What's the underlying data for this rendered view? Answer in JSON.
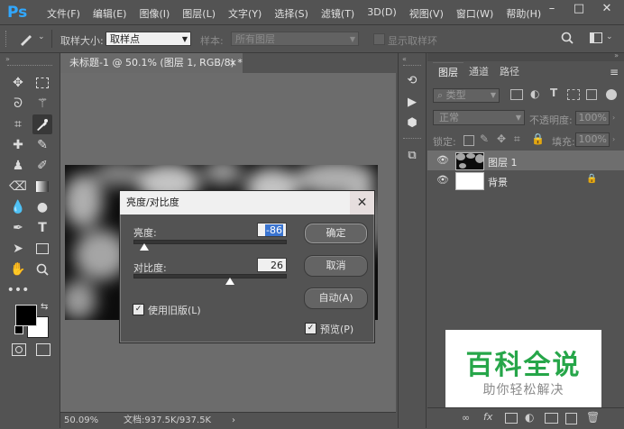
{
  "app": {
    "logo": "Ps",
    "menu": [
      "文件(F)",
      "编辑(E)",
      "图像(I)",
      "图层(L)",
      "文字(Y)",
      "选择(S)",
      "滤镜(T)",
      "3D(D)",
      "视图(V)",
      "窗口(W)",
      "帮助(H)"
    ],
    "window_controls": [
      "–",
      "□",
      "✕"
    ]
  },
  "options": {
    "sample_size_label": "取样大小:",
    "sample_size_value": "取样点",
    "sample_label": "样本:",
    "sample_value": "所有图层",
    "show_ring_label": "显示取样环"
  },
  "document": {
    "tab_title": "未标题-1 @ 50.1% (图层 1, RGB/8) *",
    "tab_close": "×",
    "zoom": "50.09%",
    "doc_info": "文档:937.5K/937.5K",
    "status_arrow": "›"
  },
  "layers_panel": {
    "tabs": [
      "图层",
      "通道",
      "路径"
    ],
    "filter_label": "类型",
    "blend_mode": "正常",
    "opacity_label": "不透明度:",
    "opacity_value": "100%",
    "lock_label": "锁定:",
    "fill_label": "填充:",
    "fill_value": "100%",
    "layers": [
      {
        "name": "图层 1",
        "selected": true,
        "thumb": "clouds"
      },
      {
        "name": "背景",
        "selected": false,
        "thumb": "white",
        "locked": true
      }
    ],
    "bottom_icons": [
      "link-icon",
      "fx-icon",
      "mask-icon",
      "adjustment-icon",
      "group-icon",
      "new-layer-icon",
      "trash-icon"
    ]
  },
  "dialog": {
    "title": "亮度/对比度",
    "close": "✕",
    "brightness_label": "亮度:",
    "brightness_value": "-86",
    "brightness_fraction": 0.07,
    "contrast_label": "对比度:",
    "contrast_value": "26",
    "contrast_fraction": 0.63,
    "ok_label": "确定",
    "cancel_label": "取消",
    "auto_label": "自动(A)",
    "legacy_label": "使用旧版(L)",
    "legacy_checked": true,
    "preview_label": "预览(P)",
    "preview_checked": true
  },
  "watermark": {
    "main": "百科全说",
    "sub": "助你轻松解决"
  },
  "colors": {
    "ui_gray": "#535353",
    "ps_blue": "#31a8ff",
    "watermark_green": "#26a649",
    "selection_blue": "#3a74d0"
  }
}
